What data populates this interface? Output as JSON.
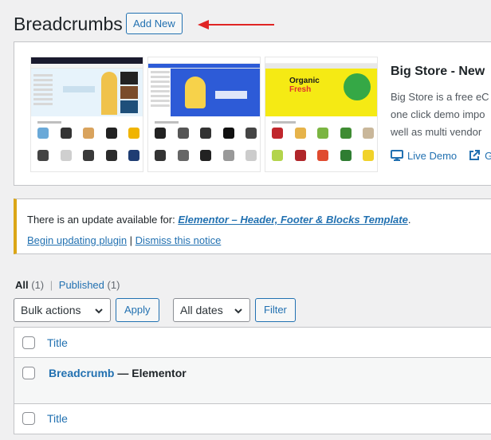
{
  "header": {
    "title": "Breadcrumbs",
    "add_new_label": "Add New"
  },
  "banner": {
    "title": "Big Store - New",
    "description_lines": [
      "Big Store is a free eC",
      "one click demo impo",
      "well as multi vendor"
    ],
    "links": [
      {
        "label": "Live Demo",
        "icon": "monitor-icon"
      },
      {
        "label": "G",
        "icon": "external-link-icon"
      }
    ],
    "shot3_text_line1": "Organic",
    "shot3_text_line2": "Fresh"
  },
  "notice": {
    "prefix": "There is an update available for: ",
    "plugin_name": "Elementor – Header, Footer & Blocks Template",
    "suffix": ".",
    "begin_update_label": "Begin updating plugin",
    "separator": " | ",
    "dismiss_label": "Dismiss this notice",
    "border_color": "#dba617"
  },
  "filters": {
    "all_label": "All",
    "all_count": "(1)",
    "separator": "|",
    "published_label": "Published",
    "published_count": "(1)"
  },
  "tablenav": {
    "bulk_actions": "Bulk actions",
    "apply_label": "Apply",
    "dates": "All dates",
    "filter_label": "Filter"
  },
  "table": {
    "header_title": "Title",
    "footer_title": "Title",
    "rows": [
      {
        "title": "Breadcrumb",
        "state": " — Elementor"
      }
    ]
  },
  "colors": {
    "link": "#2271b1",
    "annotation_arrow": "#e02424"
  }
}
